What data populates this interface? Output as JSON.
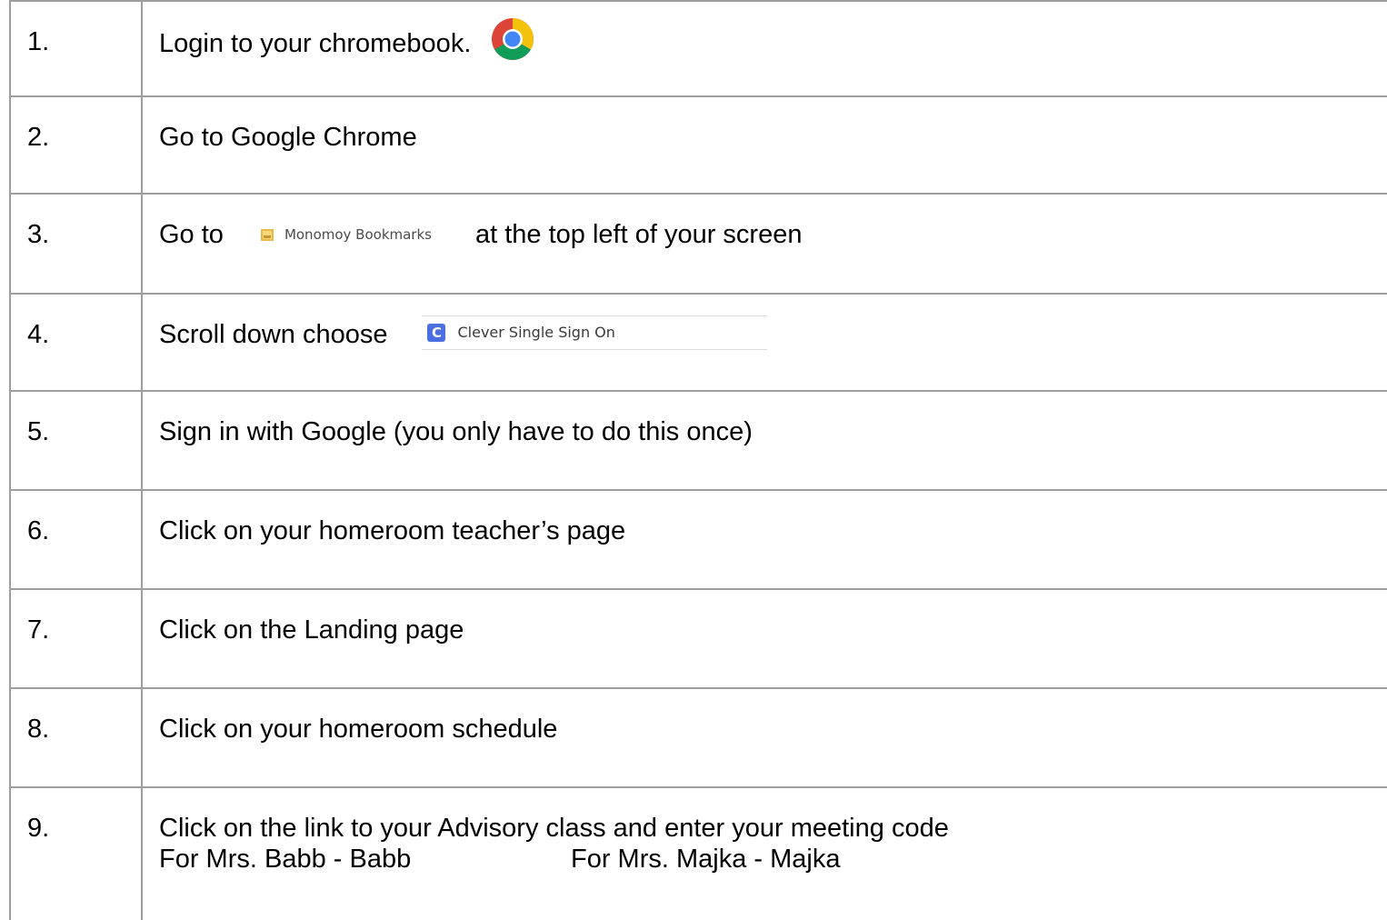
{
  "steps": [
    {
      "number": "1.",
      "text": "Login to your chromebook."
    },
    {
      "number": "2.",
      "text": "Go to Google Chrome"
    },
    {
      "number": "3.",
      "text_before": "Go to",
      "bookmark_label": "Monomoy Bookmarks",
      "text_after": "at the top left of your screen"
    },
    {
      "number": "4.",
      "text": "Scroll down choose",
      "clever_label": "Clever Single Sign On",
      "clever_letter": "C"
    },
    {
      "number": "5.",
      "text": "Sign in with Google (you only have to do this once)"
    },
    {
      "number": "6.",
      "text": "Click on your homeroom teacher’s page"
    },
    {
      "number": "7.",
      "text": "Click on the Landing page"
    },
    {
      "number": "8.",
      "text": "Click on your homeroom schedule"
    },
    {
      "number": "9.",
      "text": "Click on the link to your Advisory class  and enter your meeting code",
      "code_1": "For Mrs. Babb - Babb",
      "code_2": "For Mrs. Majka - Majka"
    }
  ],
  "icons": {
    "step1": "chrome-icon",
    "step3": "folder-icon",
    "step4": "clever-icon"
  },
  "colors": {
    "border": "#9e9e9e",
    "clever_blue": "#4a6fe3",
    "folder_yellow": "#e8b84a"
  }
}
